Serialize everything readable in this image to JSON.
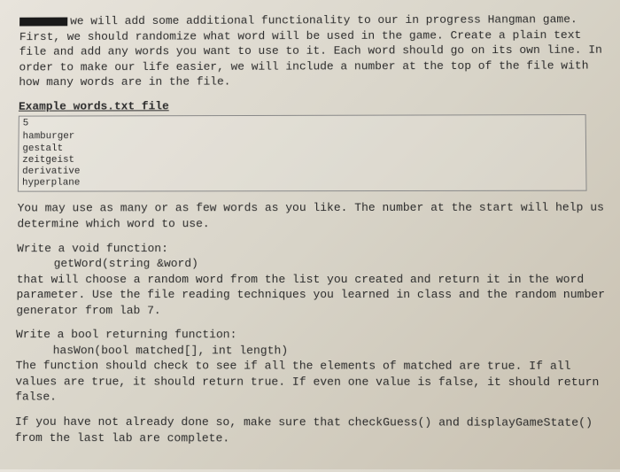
{
  "intro": "we will add some additional functionality to our in progress Hangman game.  First, we should randomize what word will be used in the game.  Create a plain text file and add any words you want to use to it.  Each word should go on its own line.  In order to make our life easier, we will include a number at the top of the file with how many words are in the file.",
  "example_heading": "Example words.txt file",
  "example": {
    "count": "5",
    "words": [
      "hamburger",
      "gestalt",
      "zeitgeist",
      "derivative",
      "hyperplane"
    ]
  },
  "para2": "You may use as many or as few words as you like.  The number at the start will help us determine which word to use.",
  "void_fn": {
    "line1": "Write a void function:",
    "sig": "getWord(string &word)",
    "desc": "that will choose a random word from the list you created and return it in the word parameter.  Use the file reading techniques you learned in class and the random number generator from lab 7."
  },
  "bool_fn": {
    "line1": "Write a bool returning function:",
    "sig": "hasWon(bool matched[], int length)",
    "desc": "The function should check to see if all the elements of matched are true.  If all values are true, it should return true.  If even one value is false, it should return false."
  },
  "final": "If you have not already done so, make sure that checkGuess() and displayGameState() from the last lab are complete."
}
